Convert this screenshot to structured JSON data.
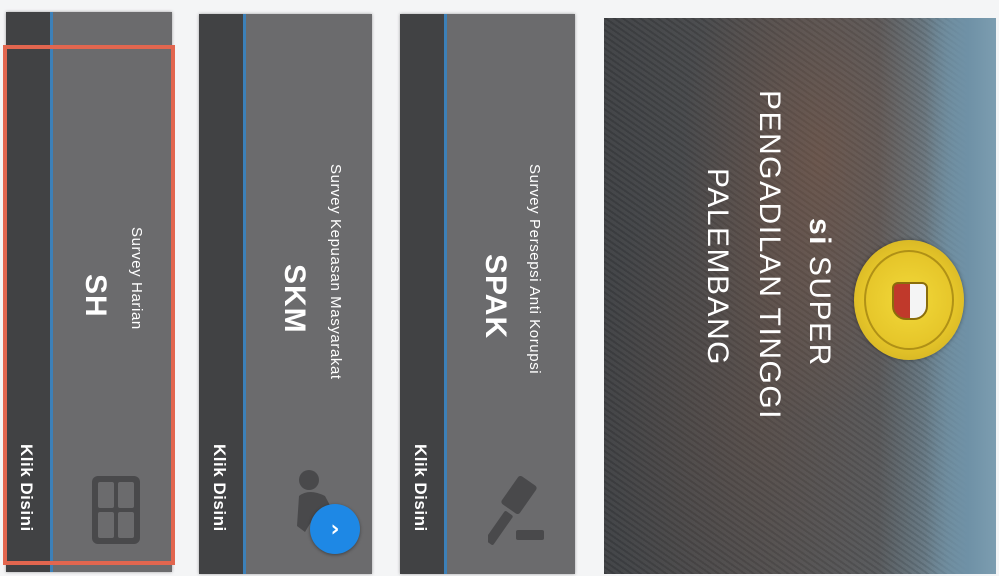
{
  "banner": {
    "line1_prefix": "si",
    "line1": "SUPER",
    "line2": "PENGADILAN TINGGI",
    "line3": "PALEMBANG"
  },
  "cards": [
    {
      "code": "SH",
      "name": "Survey Harian",
      "cta": "Klik Disini",
      "icon": "grid-icon",
      "selected": true
    },
    {
      "code": "SKM",
      "name": "Survey Kepuasan Masyarakat",
      "cta": "Klik Disini",
      "icon": "person-icon"
    },
    {
      "code": "SPAK",
      "name": "Survey Persepsi Anti Korupsi",
      "cta": "Klik Disini",
      "icon": "gavel-icon"
    }
  ],
  "scroll_button": {
    "icon": "chevron-icon",
    "glyph": "›"
  },
  "colors": {
    "card_bg": "#6b6b6d",
    "card_strip": "#414244",
    "strip_border": "#3c80b8",
    "highlight": "#e2664f",
    "button": "#1e88e5",
    "seal": "#e6c62a"
  }
}
